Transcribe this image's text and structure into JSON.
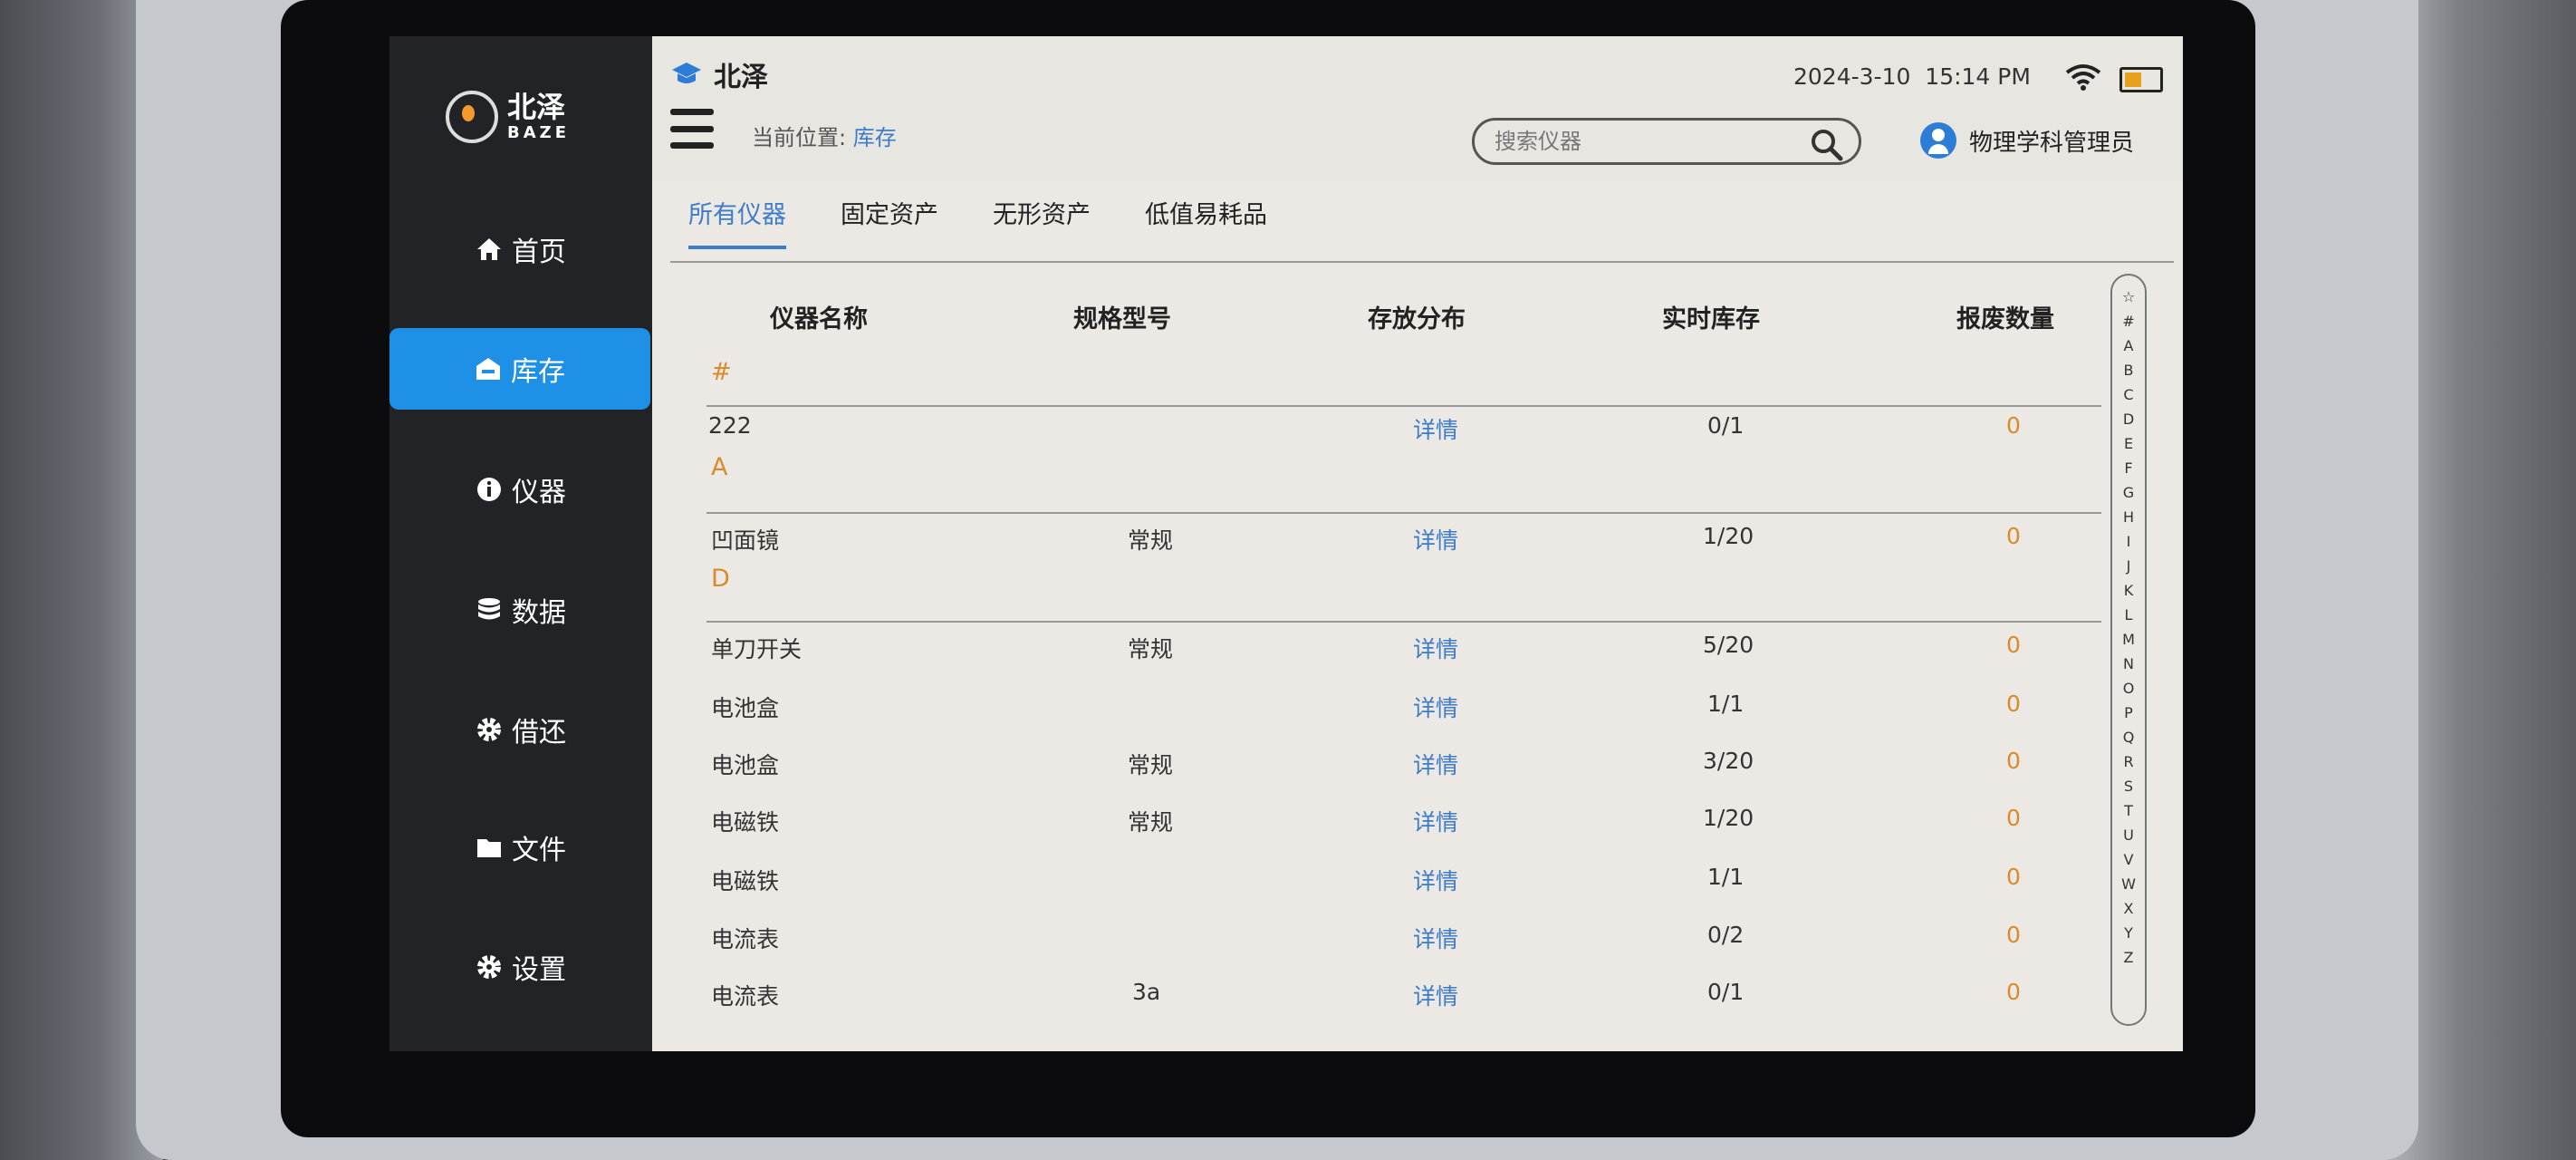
{
  "sidebar": {
    "logo_cn": "北泽",
    "logo_en": "BAZE",
    "items": [
      {
        "label": "首页",
        "icon": "home-icon"
      },
      {
        "label": "库存",
        "icon": "warehouse-icon",
        "active": true
      },
      {
        "label": "仪器",
        "icon": "info-icon"
      },
      {
        "label": "数据",
        "icon": "database-icon"
      },
      {
        "label": "借还",
        "icon": "gear-icon"
      },
      {
        "label": "文件",
        "icon": "folder-icon"
      },
      {
        "label": "设置",
        "icon": "gear-icon"
      }
    ]
  },
  "header": {
    "brand": "北泽",
    "breadcrumb_prefix": "当前位置: ",
    "breadcrumb_current": "库存",
    "date": "2024-3-10",
    "time": "15:14 PM",
    "search_placeholder": "搜索仪器",
    "user": "物理学科管理员"
  },
  "tabs": [
    "所有仪器",
    "固定资产",
    "无形资产",
    "低值易耗品"
  ],
  "table": {
    "columns": [
      "仪器名称",
      "规格型号",
      "存放分布",
      "实时库存",
      "报废数量"
    ],
    "sections": [
      {
        "letter": "#",
        "rows": [
          {
            "name": "222",
            "spec": "",
            "detail": "详情",
            "stock": "0/1",
            "scrap": "0"
          }
        ]
      },
      {
        "letter": "A",
        "rows": [
          {
            "name": "凹面镜",
            "spec": "常规",
            "detail": "详情",
            "stock": "1/20",
            "scrap": "0"
          }
        ]
      },
      {
        "letter": "D",
        "rows": [
          {
            "name": "单刀开关",
            "spec": "常规",
            "detail": "详情",
            "stock": "5/20",
            "scrap": "0"
          },
          {
            "name": "电池盒",
            "spec": "",
            "detail": "详情",
            "stock": "1/1",
            "scrap": "0"
          },
          {
            "name": "电池盒",
            "spec": "常规",
            "detail": "详情",
            "stock": "3/20",
            "scrap": "0"
          },
          {
            "name": "电磁铁",
            "spec": "常规",
            "detail": "详情",
            "stock": "1/20",
            "scrap": "0"
          },
          {
            "name": "电磁铁",
            "spec": "",
            "detail": "详情",
            "stock": "1/1",
            "scrap": "0"
          },
          {
            "name": "电流表",
            "spec": "",
            "detail": "详情",
            "stock": "0/2",
            "scrap": "0"
          },
          {
            "name": "电流表",
            "spec": "3a",
            "detail": "详情",
            "stock": "0/1",
            "scrap": "0"
          }
        ]
      }
    ]
  },
  "index_letters": [
    "☆",
    "#",
    "A",
    "B",
    "C",
    "D",
    "E",
    "F",
    "G",
    "H",
    "I",
    "J",
    "K",
    "L",
    "M",
    "N",
    "O",
    "P",
    "Q",
    "R",
    "S",
    "T",
    "U",
    "V",
    "W",
    "X",
    "Y",
    "Z"
  ],
  "colors": {
    "accent": "#1e90e6",
    "link": "#3d7cc9",
    "zero": "#d98a2a"
  }
}
